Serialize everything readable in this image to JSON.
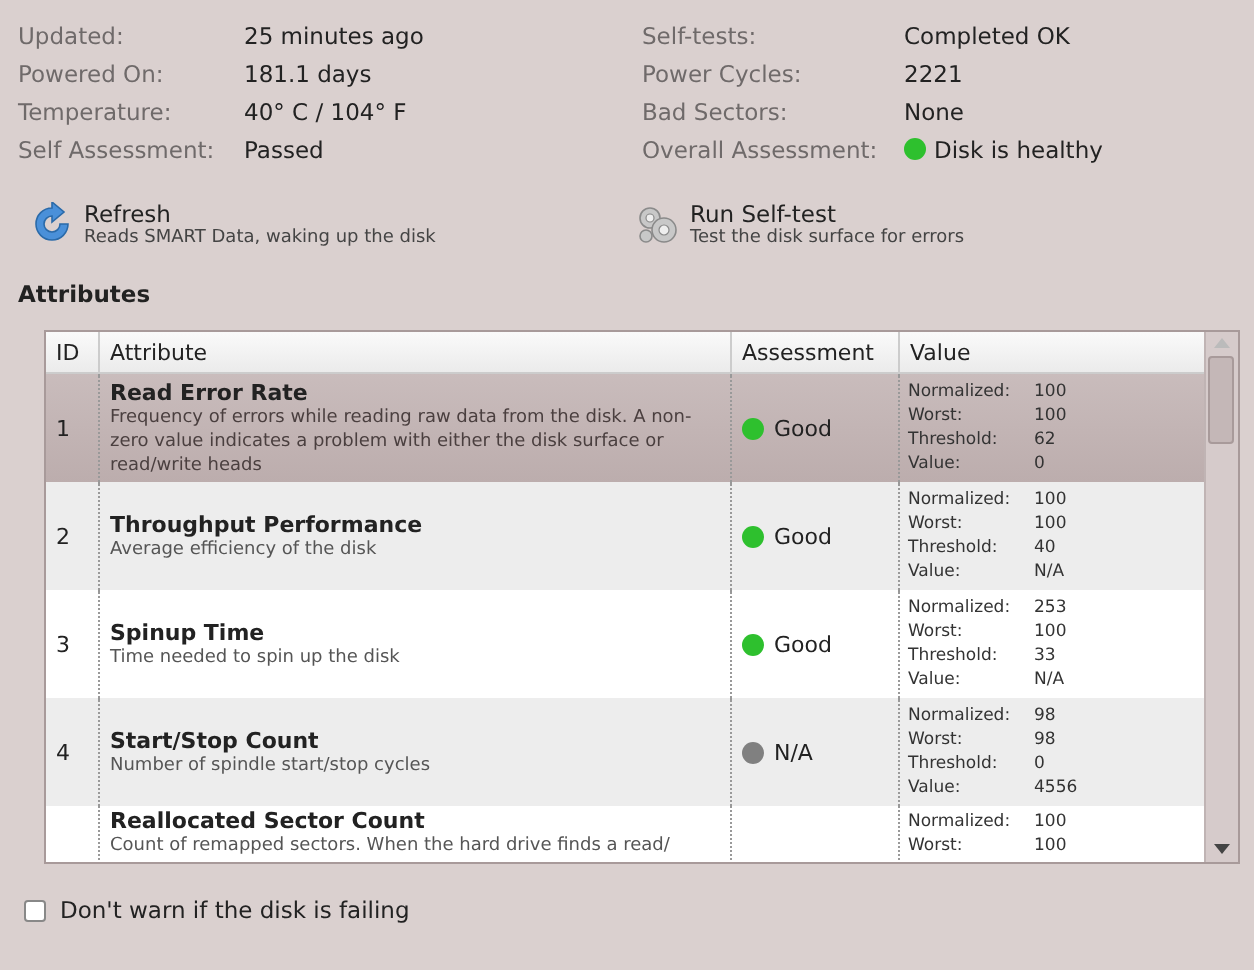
{
  "info_left": [
    {
      "label": "Updated:",
      "value": "25 minutes ago"
    },
    {
      "label": "Powered On:",
      "value": "181.1 days"
    },
    {
      "label": "Temperature:",
      "value": "40° C / 104° F"
    },
    {
      "label": "Self Assessment:",
      "value": "Passed"
    }
  ],
  "info_right": [
    {
      "label": "Self-tests:",
      "value": "Completed OK"
    },
    {
      "label": "Power Cycles:",
      "value": "2221"
    },
    {
      "label": "Bad Sectors:",
      "value": "None"
    },
    {
      "label": "Overall Assessment:",
      "value": "Disk is healthy",
      "color": "#2ec02e"
    }
  ],
  "actions": [
    {
      "kind": "refresh",
      "title": "Refresh",
      "subtitle": "Reads SMART Data, waking up the disk"
    },
    {
      "kind": "selftest",
      "title": "Run Self-test",
      "subtitle": "Test the disk surface for errors"
    }
  ],
  "attributes_heading": "Attributes",
  "table": {
    "columns": [
      "ID",
      "Attribute",
      "Assessment",
      "Value"
    ],
    "rows": [
      {
        "id": "1",
        "name": "Read Error Rate",
        "description": "Frequency of errors while reading raw data from the disk. A non-zero value indicates a problem with either the disk surface or read/write heads",
        "assessment": "Good",
        "color": "#2ec02e",
        "selected": true,
        "values": [
          {
            "label": "Normalized:",
            "value": "100"
          },
          {
            "label": "Worst:",
            "value": "100"
          },
          {
            "label": "Threshold:",
            "value": "62"
          },
          {
            "label": "Value:",
            "value": "0"
          }
        ]
      },
      {
        "id": "2",
        "name": "Throughput Performance",
        "description": "Average efficiency of the disk",
        "assessment": "Good",
        "color": "#2ec02e",
        "selected": false,
        "values": [
          {
            "label": "Normalized:",
            "value": "100"
          },
          {
            "label": "Worst:",
            "value": "100"
          },
          {
            "label": "Threshold:",
            "value": "40"
          },
          {
            "label": "Value:",
            "value": "N/A"
          }
        ]
      },
      {
        "id": "3",
        "name": "Spinup Time",
        "description": "Time needed to spin up the disk",
        "assessment": "Good",
        "color": "#2ec02e",
        "selected": false,
        "values": [
          {
            "label": "Normalized:",
            "value": "253"
          },
          {
            "label": "Worst:",
            "value": "100"
          },
          {
            "label": "Threshold:",
            "value": "33"
          },
          {
            "label": "Value:",
            "value": "N/A"
          }
        ]
      },
      {
        "id": "4",
        "name": "Start/Stop Count",
        "description": "Number of spindle start/stop cycles",
        "assessment": "N/A",
        "color": "#808080",
        "selected": false,
        "values": [
          {
            "label": "Normalized:",
            "value": "98"
          },
          {
            "label": "Worst:",
            "value": "98"
          },
          {
            "label": "Threshold:",
            "value": "0"
          },
          {
            "label": "Value:",
            "value": "4556"
          }
        ]
      },
      {
        "name": "Reallocated Sector Count",
        "description": "Count of remapped sectors. When the hard drive finds a read/",
        "selected": false,
        "values": [
          {
            "label": "Normalized:",
            "value": "100"
          },
          {
            "label": "Worst:",
            "value": "100"
          }
        ]
      }
    ]
  },
  "dont_warn": {
    "label": "Don't warn if the disk is failing",
    "checked": false
  }
}
